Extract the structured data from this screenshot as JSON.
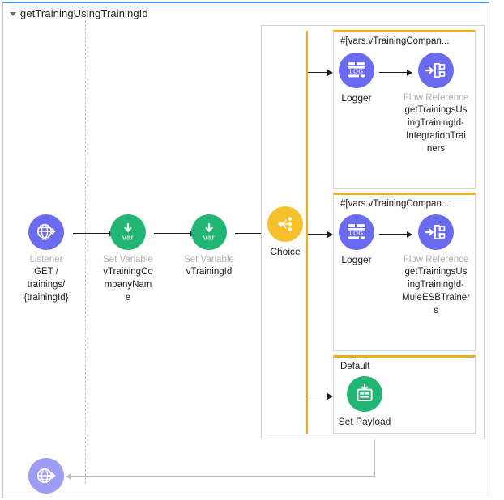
{
  "flow": {
    "title": "getTrainingUsingTrainingId"
  },
  "colors": {
    "connector_purple": "#6b6bf0",
    "transform_green": "#22b573",
    "choice_amber": "#f5c02b",
    "scope_border": "#cfcfcf",
    "branch_bar": "#f0ad20",
    "faded_label": "#b3b3b3",
    "top_accent": "#3a8fd6"
  },
  "main_nodes": [
    {
      "icon": "globe-arrow-icon",
      "type": "Listener",
      "name": "GET /\ntrainings/\n{trainingId}",
      "name_lines": [
        "GET /",
        "trainings/",
        "{trainingId}"
      ]
    },
    {
      "icon": "var-down-arrow-icon",
      "type": "Set Variable",
      "name": "vTrainingCompanyName",
      "name_lines": [
        "vTrainingCo",
        "mpanyNam",
        "e"
      ]
    },
    {
      "icon": "var-down-arrow-icon",
      "type": "Set Variable",
      "name": "vTrainingId",
      "name_lines": [
        "vTrainingId"
      ]
    }
  ],
  "choice": {
    "icon": "choice-branch-icon",
    "label": "Choice",
    "branches": [
      {
        "condition": "#[vars.vTrainingCompan...",
        "nodes": [
          {
            "icon": "logger-icon",
            "type": "Logger",
            "name": "",
            "name_lines": []
          },
          {
            "icon": "flow-reference-icon",
            "type": "Flow Reference",
            "name": "getTrainingsUsingTrainingId-IntegrationTrainers",
            "name_lines": [
              "getTrainingsUs",
              "ingTrainingId-",
              "IntegrationTrai",
              "ners"
            ]
          }
        ]
      },
      {
        "condition": "#[vars.vTrainingCompan...",
        "nodes": [
          {
            "icon": "logger-icon",
            "type": "Logger",
            "name": "",
            "name_lines": []
          },
          {
            "icon": "flow-reference-icon",
            "type": "Flow Reference",
            "name": "getTrainingsUsingTrainingId-MuleESBTrainers",
            "name_lines": [
              "getTrainingsUs",
              "ingTrainingId-",
              "MuleESBTrainer",
              "s"
            ]
          }
        ]
      },
      {
        "condition": "Default",
        "nodes": [
          {
            "icon": "set-payload-icon",
            "type": "Set Payload",
            "name": "",
            "name_lines": []
          }
        ]
      }
    ]
  },
  "response_node": {
    "icon": "globe-arrow-icon",
    "type": "",
    "name": ""
  }
}
